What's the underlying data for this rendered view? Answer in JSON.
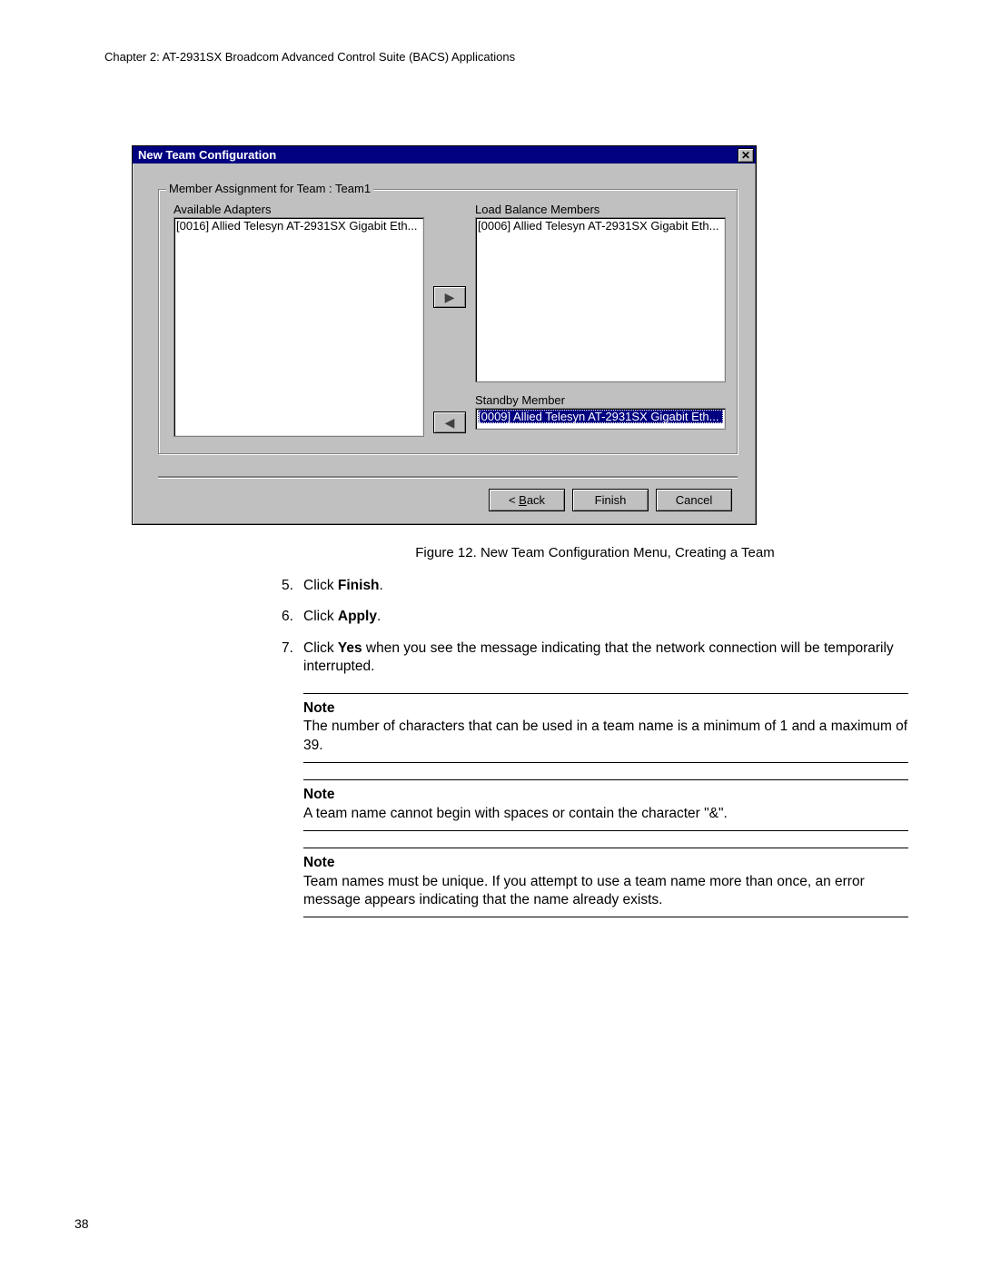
{
  "header": "Chapter 2: AT-2931SX Broadcom Advanced Control Suite (BACS) Applications",
  "dialog": {
    "title": "New Team Configuration",
    "close_glyph": "✕",
    "group_legend": "Member Assignment for Team : Team1",
    "available_label": "Available Adapters",
    "available_item": "[0016] Allied Telesyn AT-2931SX Gigabit Eth...",
    "lb_label": "Load Balance Members",
    "lb_item": "[0006] Allied Telesyn AT-2931SX Gigabit Eth...",
    "standby_label": "Standby Member",
    "standby_item": "[0009] Allied Telesyn AT-2931SX Gigabit Eth...",
    "arrow_right": "▶",
    "arrow_left": "◀",
    "back_prefix": "< ",
    "back_letter": "B",
    "back_rest": "ack",
    "finish": "Finish",
    "cancel": "Cancel"
  },
  "caption": "Figure 12. New Team Configuration Menu, Creating a Team",
  "steps": {
    "s5_num": "5.",
    "s5_a": "Click ",
    "s5_b": "Finish",
    "s5_c": ".",
    "s6_num": "6.",
    "s6_a": "Click ",
    "s6_b": "Apply",
    "s6_c": ".",
    "s7_num": "7.",
    "s7_a": "Click ",
    "s7_b": "Yes",
    "s7_c": " when you see the message indicating that the network connection will be temporarily interrupted."
  },
  "notes": {
    "label": "Note",
    "n1": "The number of characters that can be used in a team name is a minimum of 1 and a maximum of 39.",
    "n2": "A team name cannot begin with spaces or contain the character \"&\".",
    "n3": "Team names must be unique. If you attempt to use a team name more than once, an error message appears indicating that the name already exists."
  },
  "page_number": "38"
}
